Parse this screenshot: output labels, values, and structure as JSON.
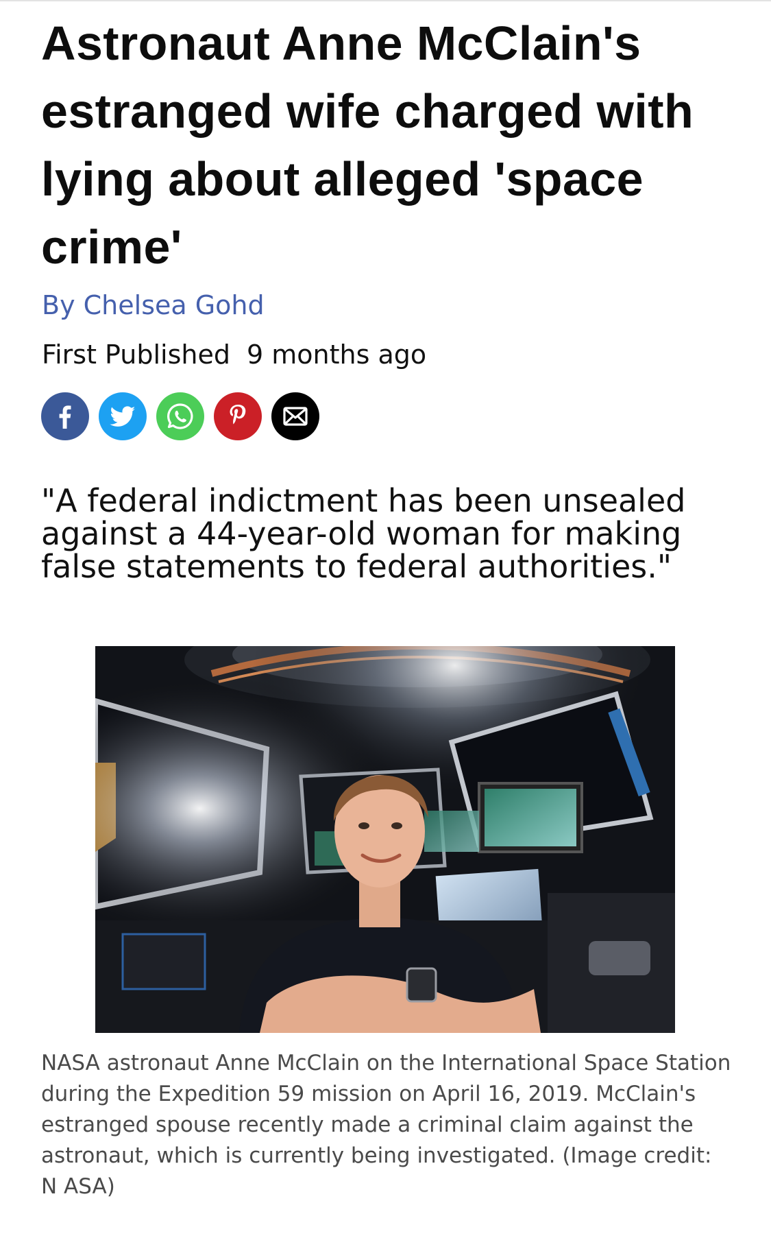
{
  "article": {
    "headline": "Astronaut Anne McClain's estranged wife charged with lying about alleged 'space crime'",
    "byline": "By Chelsea Gohd",
    "published_label": "First Published",
    "published_value": "9 months ago",
    "pull_quote": "\"A federal indictment has been unsealed against a 44-year-old woman for making false statements to federal authorities.\""
  },
  "share": {
    "buttons": [
      {
        "icon": "facebook-icon",
        "color": "#3b5998"
      },
      {
        "icon": "twitter-icon",
        "color": "#1da1f2"
      },
      {
        "icon": "whatsapp-icon",
        "color": "#4ccd58"
      },
      {
        "icon": "pinterest-icon",
        "color": "#cb2027"
      },
      {
        "icon": "email-icon",
        "color": "#000000"
      }
    ]
  },
  "image": {
    "subject": "astronaut-in-cupola-photo",
    "caption": "NASA astronaut Anne McClain on the International Space Station during the Expedition 59 mission on April 16, 2019. McClain's estranged spouse recently made a criminal claim against the astronaut, which is currently being investigated. (Image credit: N ASA)"
  },
  "colors": {
    "byline": "#4560ad",
    "text": "#111111",
    "caption": "#4a4a4a"
  }
}
